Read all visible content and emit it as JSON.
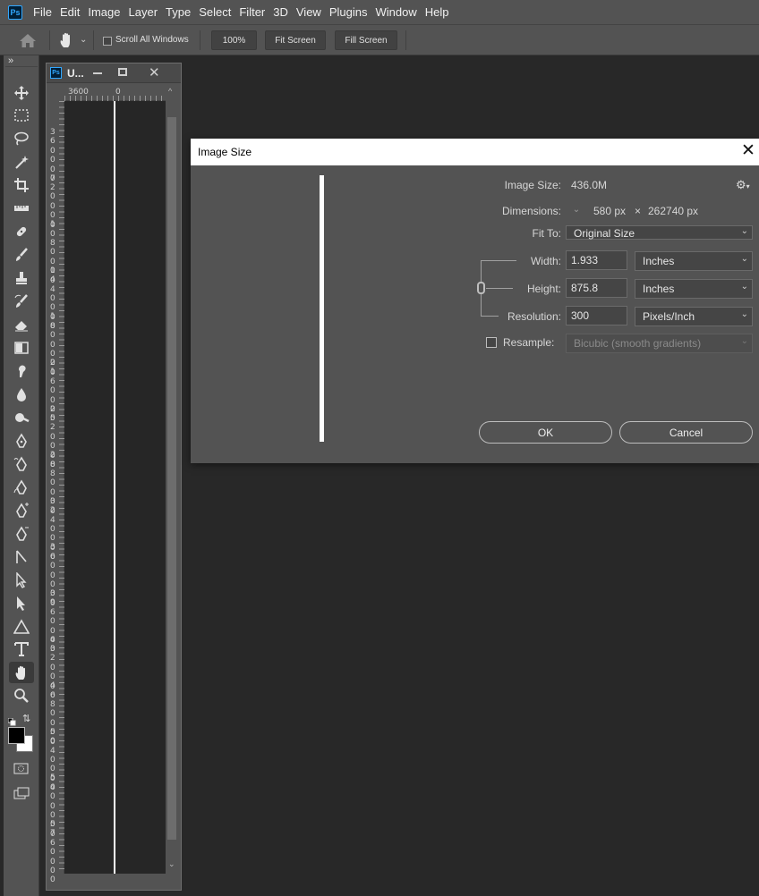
{
  "app": {
    "logo": "Ps",
    "menus": [
      "File",
      "Edit",
      "Image",
      "Layer",
      "Type",
      "Select",
      "Filter",
      "3D",
      "View",
      "Plugins",
      "Window",
      "Help"
    ]
  },
  "options_bar": {
    "scroll_all_label": "Scroll All Windows",
    "scroll_all_checked": false,
    "zoom_100_label": "100%",
    "fit_screen_label": "Fit Screen",
    "fill_screen_label": "Fill Screen"
  },
  "toolbar": {
    "collapse_label": "»",
    "tools": [
      "move-tool",
      "marquee-tool",
      "lasso-tool",
      "magic-wand-tool",
      "crop-tool",
      "ruler-tool",
      "healing-tool",
      "brush-tool",
      "stamp-tool",
      "history-brush-tool",
      "eraser-tool",
      "gradient-tool",
      "smudge-tool",
      "blur-tool",
      "dodge-tool",
      "pen-tool",
      "freeform-pen-tool",
      "curvature-pen-tool",
      "add-anchor-tool",
      "delete-anchor-tool",
      "convert-point-tool",
      "path-selection-tool",
      "direct-selection-tool",
      "shape-tool",
      "type-tool",
      "hand-tool",
      "zoom-tool"
    ],
    "active_tool": "hand-tool",
    "foreground_color": "#000000",
    "background_color": "#ffffff"
  },
  "document": {
    "ps_label": "Ps",
    "title": "U...",
    "ruler_top": [
      "3600",
      "0"
    ],
    "ruler_left": [
      "360000",
      "720000",
      "1080000",
      "1440000",
      "1800000",
      "2160000",
      "2520000",
      "2880000",
      "3240000",
      "3600000",
      "3960000",
      "4320000",
      "4680000",
      "5040000",
      "5400000",
      "5760000"
    ]
  },
  "dialog": {
    "title": "Image Size",
    "image_size_label": "Image Size:",
    "image_size_value": "436.0M",
    "dimensions_label": "Dimensions:",
    "dim_width": "580 px",
    "dim_x": "×",
    "dim_height": "262740 px",
    "fit_to_label": "Fit To:",
    "fit_to_value": "Original Size",
    "width_label": "Width:",
    "width_value": "1.933",
    "width_unit": "Inches",
    "height_label": "Height:",
    "height_value": "875.8",
    "height_unit": "Inches",
    "resolution_label": "Resolution:",
    "resolution_value": "300",
    "resolution_unit": "Pixels/Inch",
    "resample_label": "Resample:",
    "resample_checked": false,
    "resample_value": "Bicubic (smooth gradients)",
    "ok_label": "OK",
    "cancel_label": "Cancel"
  }
}
